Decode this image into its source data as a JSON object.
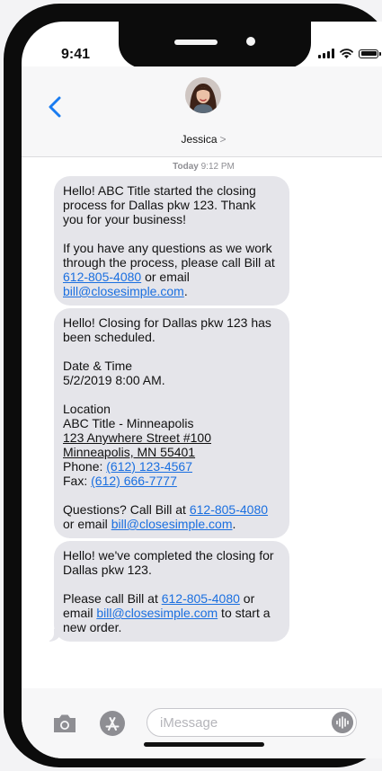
{
  "status_bar": {
    "time": "9:41"
  },
  "header": {
    "contact_name": "Jessica",
    "contact_chevron": ">"
  },
  "thread": {
    "timestamp_day": "Today",
    "timestamp_time": "9:12 PM",
    "messages": [
      {
        "p1": "Hello! ABC Title started the closing process for Dallas pkw 123. Thank you for your business!",
        "p2_text1": "If you have any questions as we work through the process, please call Bill at ",
        "p2_phone": "612-805-4080",
        "p2_text2": " or email ",
        "p2_email": "bill@closesimple.com",
        "p2_end": "."
      },
      {
        "p1": "Hello! Closing for Dallas pkw 123 has been scheduled.",
        "dt_label": "Date & Time",
        "dt_value": "5/2/2019 8:00 AM.",
        "loc_label": "Location",
        "loc_name": "ABC Title - Minneapolis",
        "loc_street": "123 Anywhere Street #100",
        "loc_city": "Minneapolis, MN 55401",
        "phone_label": "Phone: ",
        "phone": "(612) 123-4567",
        "fax_label": "Fax: ",
        "fax": "(612) 666-7777",
        "q_text1": "Questions? Call Bill at ",
        "q_phone": "612-805-4080",
        "q_text2": " or email ",
        "q_email": "bill@closesimple.com",
        "q_end": "."
      },
      {
        "p1": "Hello! we've completed the closing for Dallas pkw 123.",
        "p2_text1": "Please call Bill at ",
        "p2_phone": "612-805-4080",
        "p2_text2": " or email ",
        "p2_email": "bill@closesimple.com",
        "p2_text3": " to start a new order."
      }
    ]
  },
  "input_bar": {
    "placeholder": "iMessage"
  },
  "icons": {
    "back": "chevron-left-icon",
    "camera": "camera-icon",
    "app_store": "app-store-icon",
    "audio": "audio-waveform-icon"
  },
  "colors": {
    "accent": "#1a6fe0",
    "bubble_received": "#e5e5ea",
    "phone_frame": "#0c0c0c"
  }
}
